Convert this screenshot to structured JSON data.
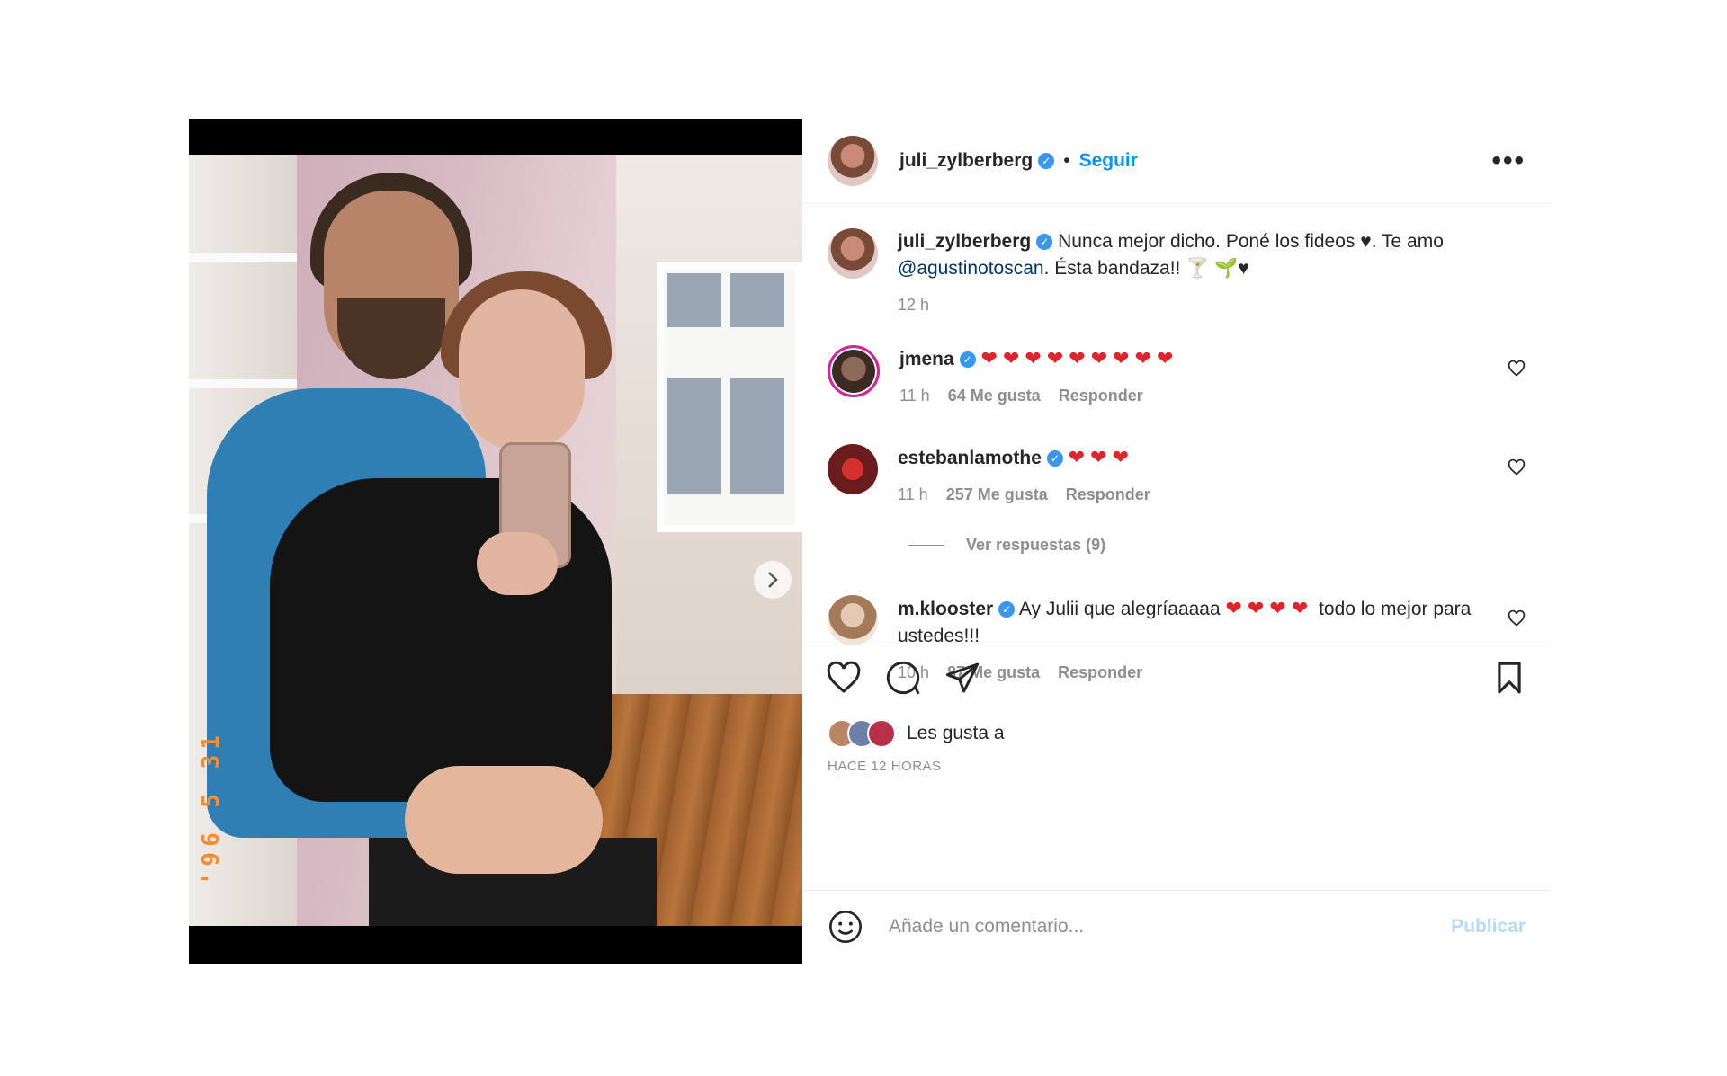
{
  "post": {
    "username": "juli_zylberberg",
    "separator": "•",
    "follow_label": "Seguir",
    "more_label": "•••",
    "date_stamp": "'96 5 31",
    "caption": {
      "username": "juli_zylberberg",
      "text_before": "Nunca mejor dicho. Poné los fideos ♥. Te amo",
      "mention": "@agustinotoscan",
      "text_after": ". Ésta bandaza!! 🍸 🌱♥",
      "time": "12 h"
    }
  },
  "comments": [
    {
      "username": "jmena",
      "text": "❤❤❤❤❤❤❤❤❤",
      "time": "11 h",
      "likes": "64 Me gusta",
      "reply": "Responder"
    },
    {
      "username": "estebanlamothe",
      "text": "❤❤❤",
      "time": "11 h",
      "likes": "257 Me gusta",
      "reply": "Responder"
    },
    {
      "username": "m.klooster",
      "text_before": "Ay Julii que alegríaaaaa",
      "hearts": "❤❤❤❤",
      "text_after": "todo lo mejor para ustedes!!!",
      "time": "10 h",
      "likes": "87 Me gusta",
      "reply": "Responder"
    }
  ],
  "view_replies": "Ver respuestas (9)",
  "likes_text": "Les gusta a",
  "time_ago": "HACE 12 HORAS",
  "comment_box": {
    "placeholder": "Añade un comentario...",
    "publish": "Publicar"
  },
  "carousel": {
    "slide_count": 3,
    "active_slide": 1
  },
  "colors": {
    "accent": "#0095f6",
    "verified": "#3897f0",
    "heart": "#e0242e",
    "muted": "#8e8e8e"
  }
}
